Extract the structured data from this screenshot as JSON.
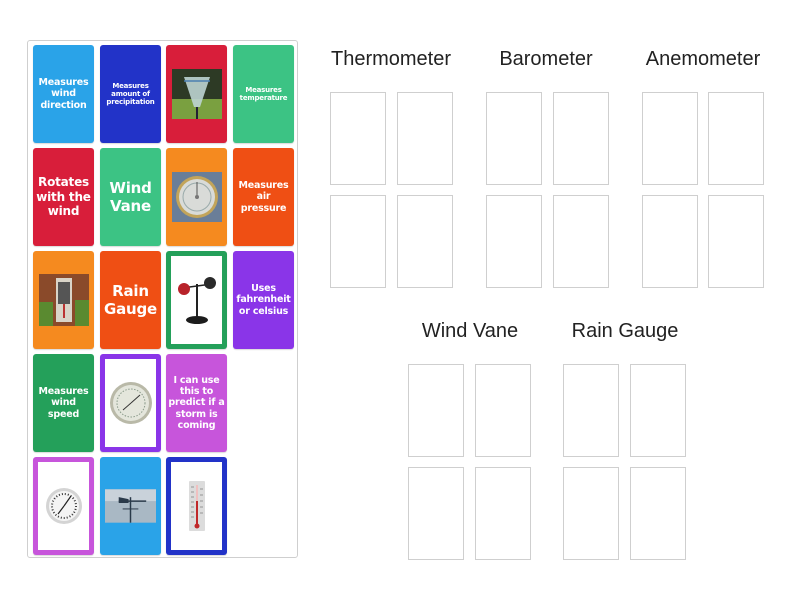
{
  "activity": {
    "type": "group-sort",
    "groups": [
      {
        "id": "thermometer",
        "title": "Thermometer",
        "slots": 4
      },
      {
        "id": "barometer",
        "title": "Barometer",
        "slots": 4
      },
      {
        "id": "anemometer",
        "title": "Anemometer",
        "slots": 4
      },
      {
        "id": "wind-vane",
        "title": "Wind Vane",
        "slots": 4
      },
      {
        "id": "rain-gauge",
        "title": "Rain Gauge",
        "slots": 4
      }
    ]
  },
  "cards": [
    {
      "kind": "text",
      "text": "Measures wind direction",
      "color": "#2aa3e8"
    },
    {
      "kind": "text",
      "text": "Measures amount of precipitation",
      "color": "#2233c8"
    },
    {
      "kind": "image",
      "image": "rain-gauge-photo",
      "color": "#d81e3a"
    },
    {
      "kind": "text",
      "text": "Measures temperature",
      "color": "#3cc384"
    },
    {
      "kind": "text",
      "text": "Rotates with the wind",
      "color": "#d81e3a"
    },
    {
      "kind": "text",
      "text": "Wind Vane",
      "color": "#3cc384"
    },
    {
      "kind": "image",
      "image": "barometer-photo",
      "color": "#f58a1f"
    },
    {
      "kind": "text",
      "text": "Measures air pressure",
      "color": "#ef4f14"
    },
    {
      "kind": "image",
      "image": "thermometer-wall-photo",
      "color": "#f58a1f"
    },
    {
      "kind": "text",
      "text": "Rain Gauge",
      "color": "#ef4f14"
    },
    {
      "kind": "image",
      "image": "anemometer-photo",
      "color": "#24a05a"
    },
    {
      "kind": "text",
      "text": "Uses fahrenheit or celsius",
      "color": "#8a35e8"
    },
    {
      "kind": "text",
      "text": "Measures wind speed",
      "color": "#24a05a"
    },
    {
      "kind": "image",
      "image": "barometer-dial-photo",
      "color": "#8a35e8"
    },
    {
      "kind": "text",
      "text": "I can use this to predict if a storm is coming",
      "color": "#c755db"
    },
    {
      "kind": "image",
      "image": "thermometer-dial-photo",
      "color": "#c755db"
    },
    {
      "kind": "image",
      "image": "weather-vane-photo",
      "color": "#2aa3e8"
    },
    {
      "kind": "image",
      "image": "thermometer-tube-photo",
      "color": "#2233c8"
    }
  ]
}
